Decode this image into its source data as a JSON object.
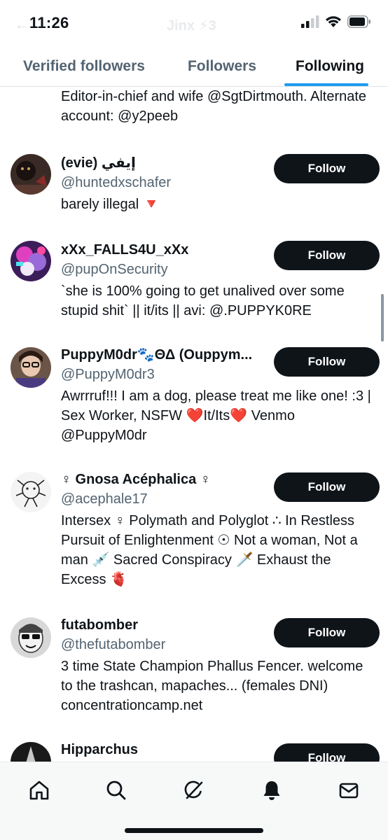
{
  "status_bar": {
    "time": "11:26",
    "faded_title": "Jinx ⚡3"
  },
  "tabs": [
    {
      "label": "Verified followers"
    },
    {
      "label": "Followers"
    },
    {
      "label": "Following",
      "active": true
    }
  ],
  "top_bio": "Editor-in-chief and wife @SgtDirtmouth. Alternate account: @y2peeb",
  "users": [
    {
      "name": "(evie) إيفي",
      "handle": "@huntedxschafer",
      "bio": "barely illegal 🔻",
      "button": "Follow"
    },
    {
      "name": "xXx_FALLS4U_xXx",
      "handle": "@pupOnSecurity",
      "bio": "`she is 100% going to get unalived over some stupid shit` || it/its || avi: @.PUPPYK0RE",
      "button": "Follow"
    },
    {
      "name": "PuppyM0dr🐾ΘΔ (Ouppym...",
      "handle": "@PuppyM0dr3",
      "bio": "Awrrruf!!! I am a dog, please treat me like one! :3 | Sex Worker, NSFW ❤️It/Its❤️ Venmo @PuppyM0dr",
      "button": "Follow"
    },
    {
      "name": "♀ Gnosa Acéphalica ♀",
      "handle": "@acephale17",
      "bio": "Intersex ♀ Polymath and Polyglot ∴ In Restless Pursuit of Enlightenment ☉ Not a woman, Not a man 💉 Sacred Conspiracy 🗡️ Exhaust the Excess 🫀",
      "button": "Follow"
    },
    {
      "name": "futabomber",
      "handle": "@thefutabomber",
      "bio": "3 time State Champion Phallus Fencer. welcome to the trashcan, mapaches... (females DNI) concentrationcamp.net",
      "button": "Follow"
    },
    {
      "name": "Hipparchus",
      "handle": "",
      "bio": "",
      "button": "Follow"
    }
  ],
  "bottom_nav": [
    {
      "icon": "home-icon"
    },
    {
      "icon": "search-icon"
    },
    {
      "icon": "grok-icon"
    },
    {
      "icon": "bell-icon"
    },
    {
      "icon": "mail-icon"
    }
  ],
  "colors": {
    "accent": "#1d9bf0",
    "button_bg": "#0f1419",
    "secondary_text": "#536471"
  }
}
